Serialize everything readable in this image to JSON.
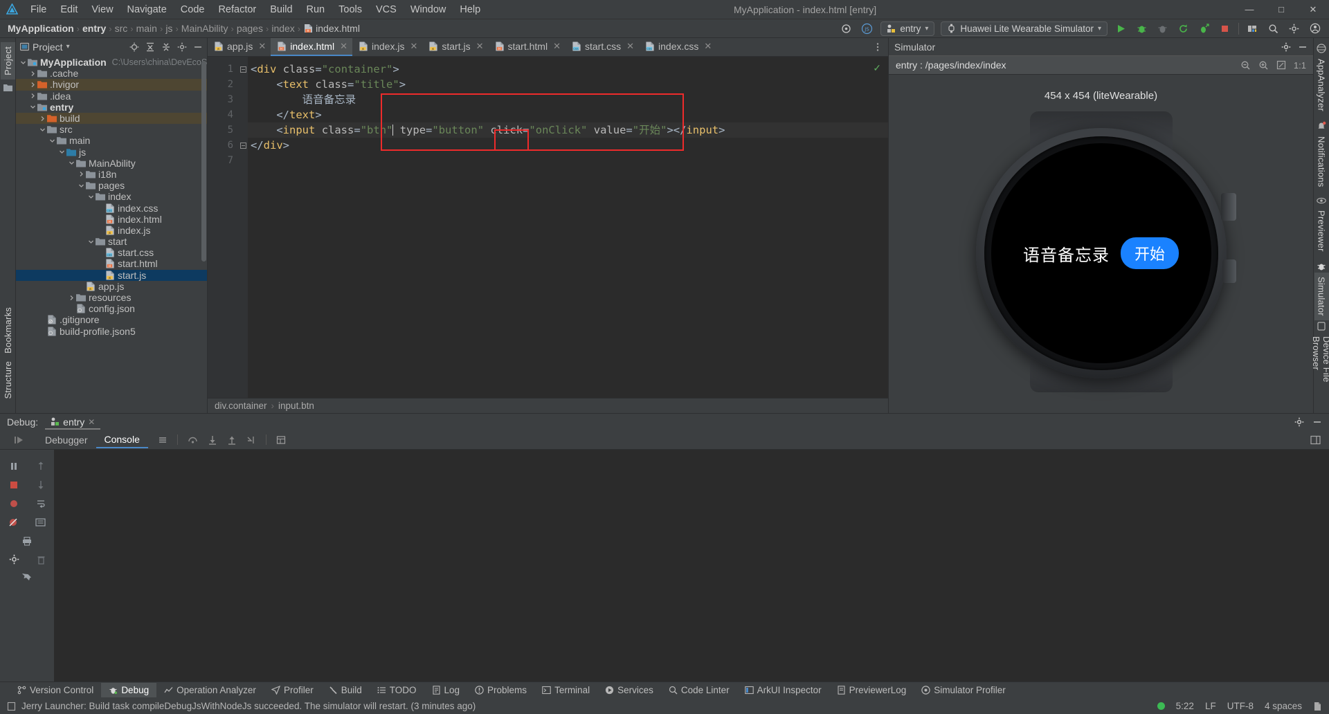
{
  "window": {
    "title": "MyApplication - index.html [entry]",
    "min_label": "—",
    "max_label": "□",
    "close_label": "✕"
  },
  "menu": [
    {
      "label": "File"
    },
    {
      "label": "Edit"
    },
    {
      "label": "View"
    },
    {
      "label": "Navigate"
    },
    {
      "label": "Code"
    },
    {
      "label": "Refactor"
    },
    {
      "label": "Build"
    },
    {
      "label": "Run"
    },
    {
      "label": "Tools"
    },
    {
      "label": "VCS"
    },
    {
      "label": "Window"
    },
    {
      "label": "Help"
    }
  ],
  "breadcrumb": {
    "items": [
      "MyApplication",
      "entry",
      "src",
      "main",
      "js",
      "MainAbility",
      "pages",
      "index"
    ],
    "file": "index.html",
    "separator": "›"
  },
  "toolbar": {
    "target_chip": "entry",
    "device_chip": "Huawei Lite Wearable Simulator",
    "dropdown_glyph": "▾",
    "run_title": "Run",
    "debug_title": "Debug",
    "attach_title": "Attach",
    "rerun_title": "Rerun",
    "profile_title": "Profile",
    "stop_title": "Stop",
    "search_title": "Search Everywhere",
    "settings_title": "Settings",
    "account_title": "Account"
  },
  "left_strip": {
    "tabs": [
      {
        "label": "Project",
        "active": true
      },
      {
        "label": "Bookmarks",
        "active": false
      },
      {
        "label": "Structure",
        "active": false
      }
    ]
  },
  "right_strip": {
    "tabs": [
      {
        "label": "AppAnalyzer",
        "active": false
      },
      {
        "label": "Notifications",
        "active": false
      },
      {
        "label": "Previewer",
        "active": false
      },
      {
        "label": "Simulator",
        "active": true
      },
      {
        "label": "Device File Browser",
        "active": false
      }
    ]
  },
  "project_panel": {
    "title": "Project",
    "dropdown_glyph": "▾",
    "actions": [
      "locate-icon",
      "expand-all-icon",
      "collapse-all-icon",
      "settings-icon",
      "hide-icon"
    ],
    "tree": [
      {
        "depth": 0,
        "arrow": "v",
        "icon": "module",
        "label": "MyApplication",
        "sub": "C:\\Users\\china\\DevEcoStudioProjec",
        "bold": true,
        "state": "normal"
      },
      {
        "depth": 1,
        "arrow": ">",
        "icon": "folder",
        "label": ".cache",
        "sub": "",
        "bold": false,
        "state": "normal"
      },
      {
        "depth": 1,
        "arrow": ">",
        "icon": "folder-orange",
        "label": ".hvigor",
        "sub": "",
        "bold": false,
        "state": "highlight"
      },
      {
        "depth": 1,
        "arrow": ">",
        "icon": "folder",
        "label": ".idea",
        "sub": "",
        "bold": false,
        "state": "normal"
      },
      {
        "depth": 1,
        "arrow": "v",
        "icon": "module",
        "label": "entry",
        "sub": "",
        "bold": true,
        "state": "normal"
      },
      {
        "depth": 2,
        "arrow": ">",
        "icon": "folder-orange",
        "label": "build",
        "sub": "",
        "bold": false,
        "state": "highlight"
      },
      {
        "depth": 2,
        "arrow": "v",
        "icon": "folder",
        "label": "src",
        "sub": "",
        "bold": false,
        "state": "normal"
      },
      {
        "depth": 3,
        "arrow": "v",
        "icon": "folder",
        "label": "main",
        "sub": "",
        "bold": false,
        "state": "normal"
      },
      {
        "depth": 4,
        "arrow": "v",
        "icon": "folder-blue",
        "label": "js",
        "sub": "",
        "bold": false,
        "state": "normal"
      },
      {
        "depth": 5,
        "arrow": "v",
        "icon": "folder",
        "label": "MainAbility",
        "sub": "",
        "bold": false,
        "state": "normal"
      },
      {
        "depth": 6,
        "arrow": ">",
        "icon": "folder",
        "label": "i18n",
        "sub": "",
        "bold": false,
        "state": "normal"
      },
      {
        "depth": 6,
        "arrow": "v",
        "icon": "folder",
        "label": "pages",
        "sub": "",
        "bold": false,
        "state": "normal"
      },
      {
        "depth": 7,
        "arrow": "v",
        "icon": "folder",
        "label": "index",
        "sub": "",
        "bold": false,
        "state": "normal"
      },
      {
        "depth": 8,
        "arrow": "",
        "icon": "file-css",
        "label": "index.css",
        "sub": "",
        "bold": false,
        "state": "normal"
      },
      {
        "depth": 8,
        "arrow": "",
        "icon": "file-html",
        "label": "index.html",
        "sub": "",
        "bold": false,
        "state": "normal"
      },
      {
        "depth": 8,
        "arrow": "",
        "icon": "file-js",
        "label": "index.js",
        "sub": "",
        "bold": false,
        "state": "normal"
      },
      {
        "depth": 7,
        "arrow": "v",
        "icon": "folder",
        "label": "start",
        "sub": "",
        "bold": false,
        "state": "normal"
      },
      {
        "depth": 8,
        "arrow": "",
        "icon": "file-css",
        "label": "start.css",
        "sub": "",
        "bold": false,
        "state": "normal"
      },
      {
        "depth": 8,
        "arrow": "",
        "icon": "file-html",
        "label": "start.html",
        "sub": "",
        "bold": false,
        "state": "normal"
      },
      {
        "depth": 8,
        "arrow": "",
        "icon": "file-js",
        "label": "start.js",
        "sub": "",
        "bold": false,
        "state": "selected"
      },
      {
        "depth": 6,
        "arrow": "",
        "icon": "file-js",
        "label": "app.js",
        "sub": "",
        "bold": false,
        "state": "normal"
      },
      {
        "depth": 5,
        "arrow": ">",
        "icon": "folder",
        "label": "resources",
        "sub": "",
        "bold": false,
        "state": "normal"
      },
      {
        "depth": 5,
        "arrow": "",
        "icon": "file-json",
        "label": "config.json",
        "sub": "",
        "bold": false,
        "state": "normal"
      },
      {
        "depth": 2,
        "arrow": "",
        "icon": "file-gitignore",
        "label": ".gitignore",
        "sub": "",
        "bold": false,
        "state": "normal"
      },
      {
        "depth": 2,
        "arrow": "",
        "icon": "file-json",
        "label": "build-profile.json5",
        "sub": "",
        "bold": false,
        "state": "normal"
      }
    ]
  },
  "editor": {
    "tabs": [
      {
        "label": "app.js",
        "icon": "file-js",
        "active": false
      },
      {
        "label": "index.html",
        "icon": "file-html",
        "active": true
      },
      {
        "label": "index.js",
        "icon": "file-js",
        "active": false
      },
      {
        "label": "start.js",
        "icon": "file-js",
        "active": false
      },
      {
        "label": "start.html",
        "icon": "file-html",
        "active": false
      },
      {
        "label": "start.css",
        "icon": "file-css",
        "active": false
      },
      {
        "label": "index.css",
        "icon": "file-css",
        "active": false
      }
    ],
    "close_glyph": "✕",
    "line_numbers": [
      "1",
      "2",
      "3",
      "4",
      "5",
      "6",
      "7"
    ],
    "lines": [
      {
        "n": 1,
        "segments": [
          {
            "t": "<",
            "c": "punc"
          },
          {
            "t": "div",
            "c": "tag"
          },
          {
            "t": " ",
            "c": "txt"
          },
          {
            "t": "class",
            "c": "attr"
          },
          {
            "t": "=",
            "c": "punc"
          },
          {
            "t": "\"container\"",
            "c": "str"
          },
          {
            "t": ">",
            "c": "punc"
          }
        ],
        "indent": 0
      },
      {
        "n": 2,
        "segments": [
          {
            "t": "<",
            "c": "punc"
          },
          {
            "t": "text",
            "c": "tag"
          },
          {
            "t": " ",
            "c": "txt"
          },
          {
            "t": "class",
            "c": "attr"
          },
          {
            "t": "=",
            "c": "punc"
          },
          {
            "t": "\"title\"",
            "c": "str"
          },
          {
            "t": ">",
            "c": "punc"
          }
        ],
        "indent": 1
      },
      {
        "n": 3,
        "segments": [
          {
            "t": "语音备忘录",
            "c": "txt"
          }
        ],
        "indent": 2
      },
      {
        "n": 4,
        "segments": [
          {
            "t": "</",
            "c": "punc"
          },
          {
            "t": "text",
            "c": "tag"
          },
          {
            "t": ">",
            "c": "punc"
          }
        ],
        "indent": 1
      },
      {
        "n": 5,
        "segments": [
          {
            "t": "<",
            "c": "punc"
          },
          {
            "t": "input",
            "c": "tag"
          },
          {
            "t": " ",
            "c": "txt"
          },
          {
            "t": "class",
            "c": "attr"
          },
          {
            "t": "=",
            "c": "punc"
          },
          {
            "t": "\"btn\"",
            "c": "str"
          },
          {
            "t": " ",
            "c": "txt"
          },
          {
            "t": "type",
            "c": "attr"
          },
          {
            "t": "=",
            "c": "punc"
          },
          {
            "t": "\"button\"",
            "c": "str"
          },
          {
            "t": " ",
            "c": "txt"
          },
          {
            "t": "click",
            "c": "attr"
          },
          {
            "t": "=",
            "c": "punc"
          },
          {
            "t": "\"onClick\"",
            "c": "str"
          },
          {
            "t": " ",
            "c": "txt"
          },
          {
            "t": "value",
            "c": "attr"
          },
          {
            "t": "=",
            "c": "punc"
          },
          {
            "t": "\"开始\"",
            "c": "str"
          },
          {
            "t": ">",
            "c": "punc"
          },
          {
            "t": "</",
            "c": "punc"
          },
          {
            "t": "input",
            "c": "tag"
          },
          {
            "t": ">",
            "c": "punc"
          }
        ],
        "indent": 1
      },
      {
        "n": 6,
        "segments": [
          {
            "t": "</",
            "c": "punc"
          },
          {
            "t": "div",
            "c": "tag"
          },
          {
            "t": ">",
            "c": "punc"
          }
        ],
        "indent": 0
      },
      {
        "n": 7,
        "segments": [],
        "indent": 0
      }
    ],
    "annotation_boxes": [
      {
        "name": "big-red-highlight-box",
        "color": "#ee2b2b"
      },
      {
        "name": "onclick-red-highlight-box",
        "color": "#ee2b2b"
      }
    ],
    "inspection_ok_glyph": "✓",
    "status_breadcrumb": [
      "div.container",
      "input.btn"
    ],
    "status_breadcrumb_sep": "›"
  },
  "simulator": {
    "title": "Simulator",
    "url": "entry : /pages/index/index",
    "zoom_out_icon": "zoom-out-icon",
    "zoom_in_icon": "zoom-in-icon",
    "fit_icon": "fit-screen-icon",
    "scale_label": "1:1",
    "device_size": "454 x 454 (liteWearable)",
    "screen": {
      "title_text": "语音备忘录",
      "button_text": "开始",
      "button_color": "#1a82ff",
      "background": "#000000"
    },
    "settings_icon": "gear-icon",
    "minimize_icon": "minimize-icon"
  },
  "debug": {
    "label": "Debug:",
    "config_tab": "entry",
    "close_glyph": "✕",
    "tabs": [
      {
        "label": "Debugger",
        "active": false
      },
      {
        "label": "Console",
        "active": true
      }
    ],
    "console_text": "",
    "tool_icons": [
      "resume-icon",
      "pause-icon",
      "stop-icon",
      "mute-breakpoints-icon",
      "view-breakpoints-icon",
      "settings-icon",
      "pin-icon"
    ],
    "step_icons": [
      "step-over-icon",
      "step-into-icon",
      "step-out-icon",
      "run-to-cursor-icon",
      "evaluate-icon"
    ],
    "settings_icon": "gear-icon",
    "minimize_icon": "minimize-icon"
  },
  "tool_windows": [
    {
      "label": "Version Control",
      "icon": "branch-icon",
      "active": false
    },
    {
      "label": "Debug",
      "icon": "bug-icon",
      "active": true
    },
    {
      "label": "Operation Analyzer",
      "icon": "chart-icon",
      "active": false
    },
    {
      "label": "Profiler",
      "icon": "profiler-icon",
      "active": false
    },
    {
      "label": "Build",
      "icon": "hammer-icon",
      "active": false
    },
    {
      "label": "TODO",
      "icon": "list-icon",
      "active": false
    },
    {
      "label": "Log",
      "icon": "log-icon",
      "active": false
    },
    {
      "label": "Problems",
      "icon": "warning-icon",
      "active": false
    },
    {
      "label": "Terminal",
      "icon": "terminal-icon",
      "active": false
    },
    {
      "label": "Services",
      "icon": "play-circle-icon",
      "active": false
    },
    {
      "label": "Code Linter",
      "icon": "linter-icon",
      "active": false
    },
    {
      "label": "ArkUI Inspector",
      "icon": "inspector-icon",
      "active": false
    },
    {
      "label": "PreviewerLog",
      "icon": "previewer-log-icon",
      "active": false
    },
    {
      "label": "Simulator Profiler",
      "icon": "simulator-profiler-icon",
      "active": false
    }
  ],
  "status": {
    "message": "Jerry Launcher: Build task compileDebugJsWithNodeJs succeeded. The simulator will restart. (3 minutes ago)",
    "message_icon": "event-log-icon",
    "caret_position": "5:22",
    "line_separator": "LF",
    "encoding": "UTF-8",
    "indent": "4 spaces",
    "vcs_icon": "branch-icon",
    "indicator_color": "#3cba54"
  }
}
